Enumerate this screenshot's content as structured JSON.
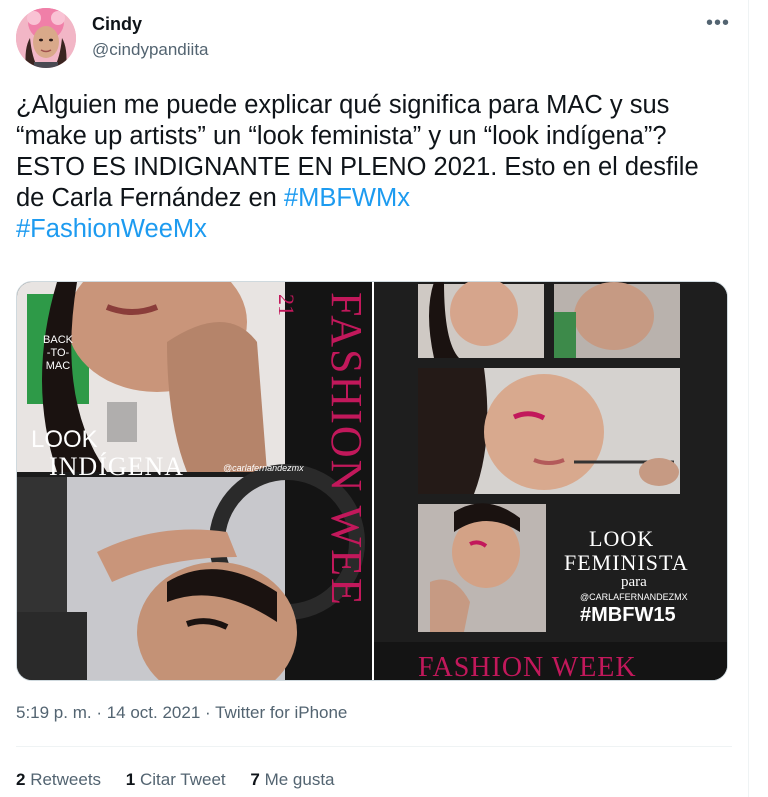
{
  "user": {
    "name": "Cindy",
    "handle": "@cindypandiita"
  },
  "more_label": "•••",
  "tweet": {
    "text_1": "¿Alguien me puede explicar qué significa para MAC y sus “make up artists” un “look feminista” y un “look indígena”?  ESTO ES INDIGNANTE EN PLENO 2021. Esto en el desfile de Carla Fernández en ",
    "hashtag_1": "#MBFWMx",
    "hashtag_2": "#FashionWeeMx"
  },
  "media": {
    "left": {
      "bag_text": "BACK\n-TO-\nMAC",
      "look_label": "LOOK",
      "look_title": "INDÍGENA",
      "credit": "@carlafernandezmx",
      "vertical_text": "FASHION WEE",
      "year_fragment": "21"
    },
    "right": {
      "look_label": "LOOK",
      "look_title": "FEMINISTA",
      "para": "para",
      "credit": "@CARLAFERNANDEZMX",
      "hashtag": "#MBFW15",
      "banner": "FASHION WEEK"
    }
  },
  "meta": {
    "time": "5:19 p. m.",
    "sep1": " · ",
    "date": "14 oct. 2021",
    "sep2": " · ",
    "source": "Twitter for iPhone"
  },
  "stats": {
    "retweets_count": "2",
    "retweets_label": " Retweets",
    "quotes_count": "1",
    "quotes_label": " Citar Tweet",
    "likes_count": "7",
    "likes_label": " Me gusta"
  },
  "colors": {
    "link": "#1d9bf0",
    "secondary": "#536471",
    "magenta": "#c2185b"
  }
}
